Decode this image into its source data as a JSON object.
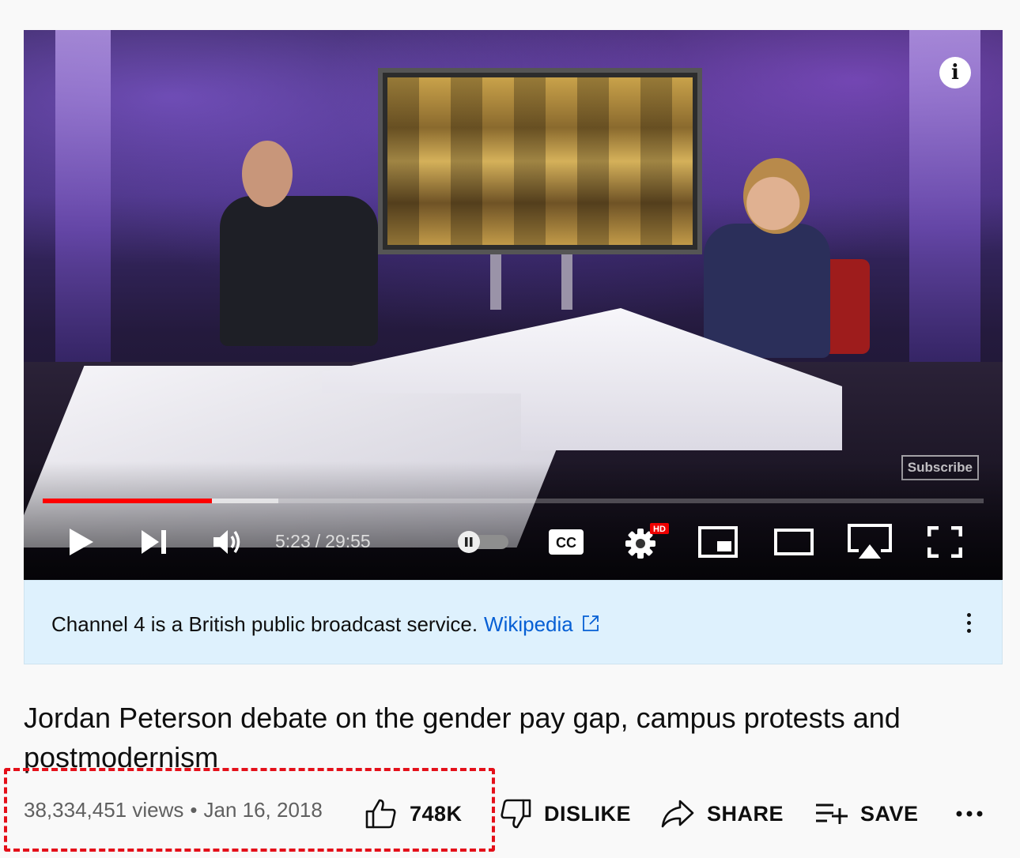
{
  "player": {
    "info_icon": "info-icon",
    "watermark": "Subscribe",
    "current_time": "5:23",
    "duration": "29:55",
    "time_separator": "/",
    "played_fraction": 0.18,
    "loaded_fraction": 0.25,
    "hd_badge": "HD",
    "controls": [
      "play-icon",
      "next-icon",
      "volume-icon",
      "autoplay-toggle",
      "captions-icon",
      "settings-icon",
      "miniplayer-icon",
      "theater-icon",
      "airplay-icon",
      "fullscreen-icon"
    ],
    "captions_label": "CC",
    "accent_color": "#ff0000"
  },
  "info_panel": {
    "text": "Channel 4 is a British public broadcast service.",
    "link_text": "Wikipedia",
    "background": "#def1fd"
  },
  "video": {
    "title": "Jordan Peterson debate on the gender pay gap, campus protests and postmodernism",
    "views": "38,334,451 views",
    "date_separator": "•",
    "date": "Jan 16, 2018"
  },
  "actions": {
    "like_count": "748K",
    "dislike_label": "DISLIKE",
    "share_label": "SHARE",
    "save_label": "SAVE"
  },
  "annotation": {
    "highlight_color": "#e4101a"
  }
}
